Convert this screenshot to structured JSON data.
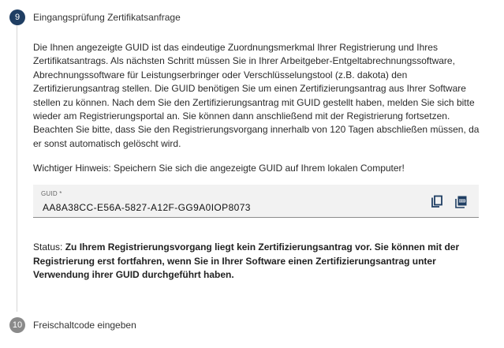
{
  "steps": {
    "current": {
      "number": "9",
      "title": "Eingangsprüfung Zertifikatsanfrage"
    },
    "next": {
      "number": "10",
      "title": "Freischaltcode eingeben"
    }
  },
  "content": {
    "intro": "Die Ihnen angezeigte GUID ist das eindeutige Zuordnungsmerkmal Ihrer Registrierung und Ihres Zertifikatsantrags. Als nächsten Schritt müssen Sie in Ihrer Arbeitgeber-Entgeltabrechnungssoftware, Abrechnungssoftware für Leistungserbringer oder Verschlüsselungstool (z.B. dakota) den Zertifizierungsantrag stellen. Die GUID benötigen Sie um einen Zertifizierungsantrag aus Ihrer Software stellen zu können. Nach dem Sie den Zertifizierungsantrag mit GUID gestellt haben, melden Sie sich bitte wieder am Registrierungsportal an. Sie können dann anschließend mit der Registrierung fortsetzen. Beachten Sie bitte, dass Sie den Registrierungsvorgang innerhalb von 120 Tagen abschließen müssen, da er sonst automatisch gelöscht wird.",
    "hint": "Wichtiger Hinweis: Speichern Sie sich die angezeigte GUID auf Ihrem lokalen Computer!",
    "guid": {
      "label": "GUID *",
      "value": "AA8A38CC-E56A-5827-A12F-GG9A0IOP8073",
      "copy_icon": "copy-icon",
      "pdf_icon": "pdf-icon"
    },
    "status": {
      "prefix": "Status:",
      "message": "Zu Ihrem Registrierungsvorgang liegt kein Zertifizierungsantrag vor. Sie können mit der Registrierung erst fortfahren, wenn Sie in Ihrer Software einen Zertifizierungsantrag unter Verwendung ihrer GUID durchgeführt haben."
    }
  },
  "colors": {
    "active_step": "#1f3e63",
    "inactive_step": "#8a8a8a",
    "icon": "#1f3e63"
  }
}
